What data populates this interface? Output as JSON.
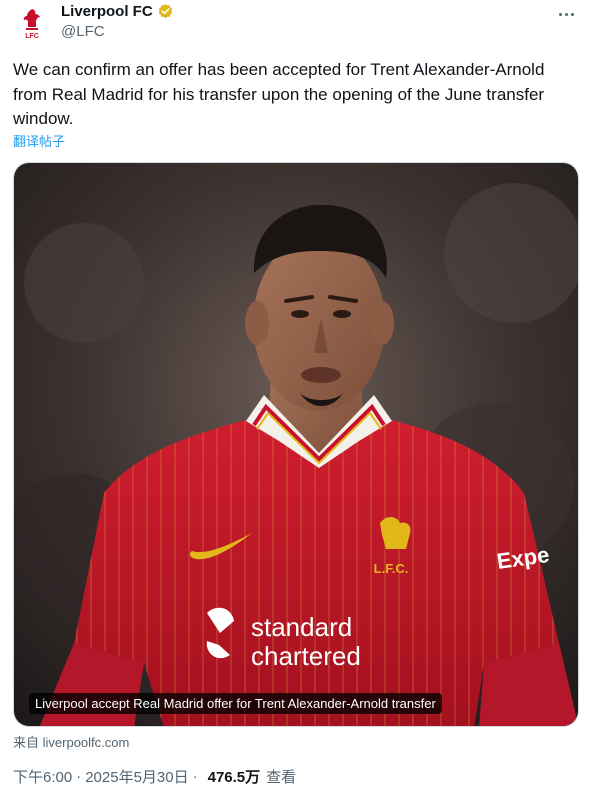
{
  "author": {
    "display_name": "Liverpool FC",
    "handle": "@LFC",
    "avatar_icon": "liverbird-crest-icon",
    "verified_icon": "gold-verified-badge-icon",
    "avatar_text": "LFC"
  },
  "more_icon": "more-horizontal-icon",
  "tweet": {
    "text": "We can confirm an offer has been accepted for Trent Alexander-Arnold from Real Madrid for his transfer upon the opening of the June transfer window.",
    "translate_label": "翻译帖子"
  },
  "media": {
    "caption": "Liverpool accept Real Madrid offer for Trent Alexander-Arnold transfer",
    "shirt_sponsor_line1": "standard",
    "shirt_sponsor_line2": "chartered",
    "shirt_crest_text": "L.F.C.",
    "sleeve_text": "Expe"
  },
  "source": {
    "prefix": "来自",
    "domain": "liverpoolfc.com"
  },
  "meta": {
    "time": "下午6:00",
    "separator": "·",
    "date": "2025年5月30日",
    "views_count": "476.5万",
    "views_label": "查看"
  },
  "colors": {
    "accent": "#1d9bf0",
    "secondary_text": "#536471",
    "liverpool_red": "#c8102e",
    "verified_gold": "#e2b719"
  }
}
